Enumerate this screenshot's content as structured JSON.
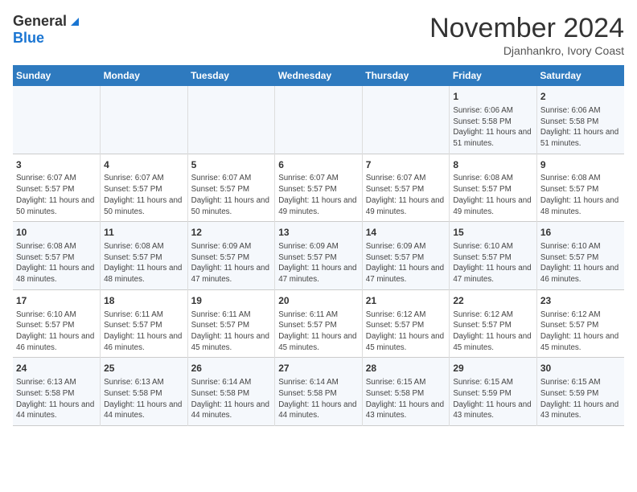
{
  "header": {
    "logo_general": "General",
    "logo_blue": "Blue",
    "month_title": "November 2024",
    "location": "Djanhankro, Ivory Coast"
  },
  "weekdays": [
    "Sunday",
    "Monday",
    "Tuesday",
    "Wednesday",
    "Thursday",
    "Friday",
    "Saturday"
  ],
  "weeks": [
    [
      {
        "day": "",
        "info": ""
      },
      {
        "day": "",
        "info": ""
      },
      {
        "day": "",
        "info": ""
      },
      {
        "day": "",
        "info": ""
      },
      {
        "day": "",
        "info": ""
      },
      {
        "day": "1",
        "info": "Sunrise: 6:06 AM\nSunset: 5:58 PM\nDaylight: 11 hours and 51 minutes."
      },
      {
        "day": "2",
        "info": "Sunrise: 6:06 AM\nSunset: 5:58 PM\nDaylight: 11 hours and 51 minutes."
      }
    ],
    [
      {
        "day": "3",
        "info": "Sunrise: 6:07 AM\nSunset: 5:57 PM\nDaylight: 11 hours and 50 minutes."
      },
      {
        "day": "4",
        "info": "Sunrise: 6:07 AM\nSunset: 5:57 PM\nDaylight: 11 hours and 50 minutes."
      },
      {
        "day": "5",
        "info": "Sunrise: 6:07 AM\nSunset: 5:57 PM\nDaylight: 11 hours and 50 minutes."
      },
      {
        "day": "6",
        "info": "Sunrise: 6:07 AM\nSunset: 5:57 PM\nDaylight: 11 hours and 49 minutes."
      },
      {
        "day": "7",
        "info": "Sunrise: 6:07 AM\nSunset: 5:57 PM\nDaylight: 11 hours and 49 minutes."
      },
      {
        "day": "8",
        "info": "Sunrise: 6:08 AM\nSunset: 5:57 PM\nDaylight: 11 hours and 49 minutes."
      },
      {
        "day": "9",
        "info": "Sunrise: 6:08 AM\nSunset: 5:57 PM\nDaylight: 11 hours and 48 minutes."
      }
    ],
    [
      {
        "day": "10",
        "info": "Sunrise: 6:08 AM\nSunset: 5:57 PM\nDaylight: 11 hours and 48 minutes."
      },
      {
        "day": "11",
        "info": "Sunrise: 6:08 AM\nSunset: 5:57 PM\nDaylight: 11 hours and 48 minutes."
      },
      {
        "day": "12",
        "info": "Sunrise: 6:09 AM\nSunset: 5:57 PM\nDaylight: 11 hours and 47 minutes."
      },
      {
        "day": "13",
        "info": "Sunrise: 6:09 AM\nSunset: 5:57 PM\nDaylight: 11 hours and 47 minutes."
      },
      {
        "day": "14",
        "info": "Sunrise: 6:09 AM\nSunset: 5:57 PM\nDaylight: 11 hours and 47 minutes."
      },
      {
        "day": "15",
        "info": "Sunrise: 6:10 AM\nSunset: 5:57 PM\nDaylight: 11 hours and 47 minutes."
      },
      {
        "day": "16",
        "info": "Sunrise: 6:10 AM\nSunset: 5:57 PM\nDaylight: 11 hours and 46 minutes."
      }
    ],
    [
      {
        "day": "17",
        "info": "Sunrise: 6:10 AM\nSunset: 5:57 PM\nDaylight: 11 hours and 46 minutes."
      },
      {
        "day": "18",
        "info": "Sunrise: 6:11 AM\nSunset: 5:57 PM\nDaylight: 11 hours and 46 minutes."
      },
      {
        "day": "19",
        "info": "Sunrise: 6:11 AM\nSunset: 5:57 PM\nDaylight: 11 hours and 45 minutes."
      },
      {
        "day": "20",
        "info": "Sunrise: 6:11 AM\nSunset: 5:57 PM\nDaylight: 11 hours and 45 minutes."
      },
      {
        "day": "21",
        "info": "Sunrise: 6:12 AM\nSunset: 5:57 PM\nDaylight: 11 hours and 45 minutes."
      },
      {
        "day": "22",
        "info": "Sunrise: 6:12 AM\nSunset: 5:57 PM\nDaylight: 11 hours and 45 minutes."
      },
      {
        "day": "23",
        "info": "Sunrise: 6:12 AM\nSunset: 5:57 PM\nDaylight: 11 hours and 45 minutes."
      }
    ],
    [
      {
        "day": "24",
        "info": "Sunrise: 6:13 AM\nSunset: 5:58 PM\nDaylight: 11 hours and 44 minutes."
      },
      {
        "day": "25",
        "info": "Sunrise: 6:13 AM\nSunset: 5:58 PM\nDaylight: 11 hours and 44 minutes."
      },
      {
        "day": "26",
        "info": "Sunrise: 6:14 AM\nSunset: 5:58 PM\nDaylight: 11 hours and 44 minutes."
      },
      {
        "day": "27",
        "info": "Sunrise: 6:14 AM\nSunset: 5:58 PM\nDaylight: 11 hours and 44 minutes."
      },
      {
        "day": "28",
        "info": "Sunrise: 6:15 AM\nSunset: 5:58 PM\nDaylight: 11 hours and 43 minutes."
      },
      {
        "day": "29",
        "info": "Sunrise: 6:15 AM\nSunset: 5:59 PM\nDaylight: 11 hours and 43 minutes."
      },
      {
        "day": "30",
        "info": "Sunrise: 6:15 AM\nSunset: 5:59 PM\nDaylight: 11 hours and 43 minutes."
      }
    ]
  ]
}
